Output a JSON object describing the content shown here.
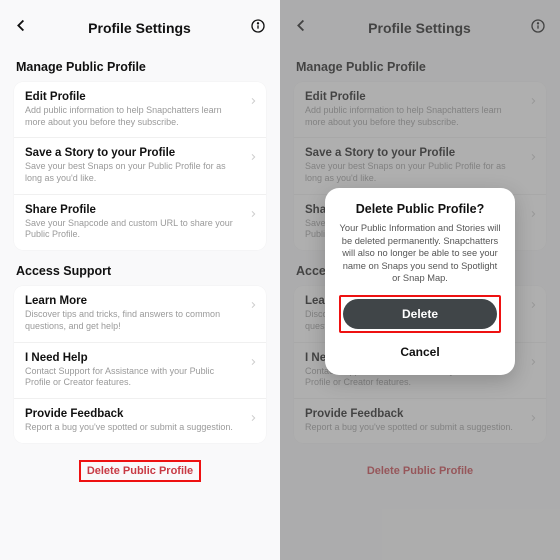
{
  "header": {
    "title": "Profile Settings"
  },
  "sections": {
    "manage": {
      "title": "Manage Public Profile",
      "items": [
        {
          "title": "Edit Profile",
          "sub": "Add public information to help Snapchatters learn more about you before they subscribe."
        },
        {
          "title": "Save a Story to your Profile",
          "sub": "Save your best Snaps on your Public Profile for as long as you'd like."
        },
        {
          "title": "Share Profile",
          "sub": "Save your Snapcode and custom URL to share your Public Profile."
        }
      ]
    },
    "support": {
      "title": "Access Support",
      "items": [
        {
          "title": "Learn More",
          "sub": "Discover tips and tricks, find answers to common questions, and get help!"
        },
        {
          "title": "I Need Help",
          "sub": "Contact Support for Assistance with your Public Profile or Creator features."
        },
        {
          "title": "Provide Feedback",
          "sub": "Report a bug you've spotted or submit a suggestion."
        }
      ]
    }
  },
  "delete_link": "Delete Public Profile",
  "dialog": {
    "title": "Delete Public Profile?",
    "body": "Your Public Information and Stories will be deleted permanently. Snapchatters will also no longer be able to see your name on Snaps you send to Spotlight or Snap Map.",
    "delete": "Delete",
    "cancel": "Cancel"
  }
}
